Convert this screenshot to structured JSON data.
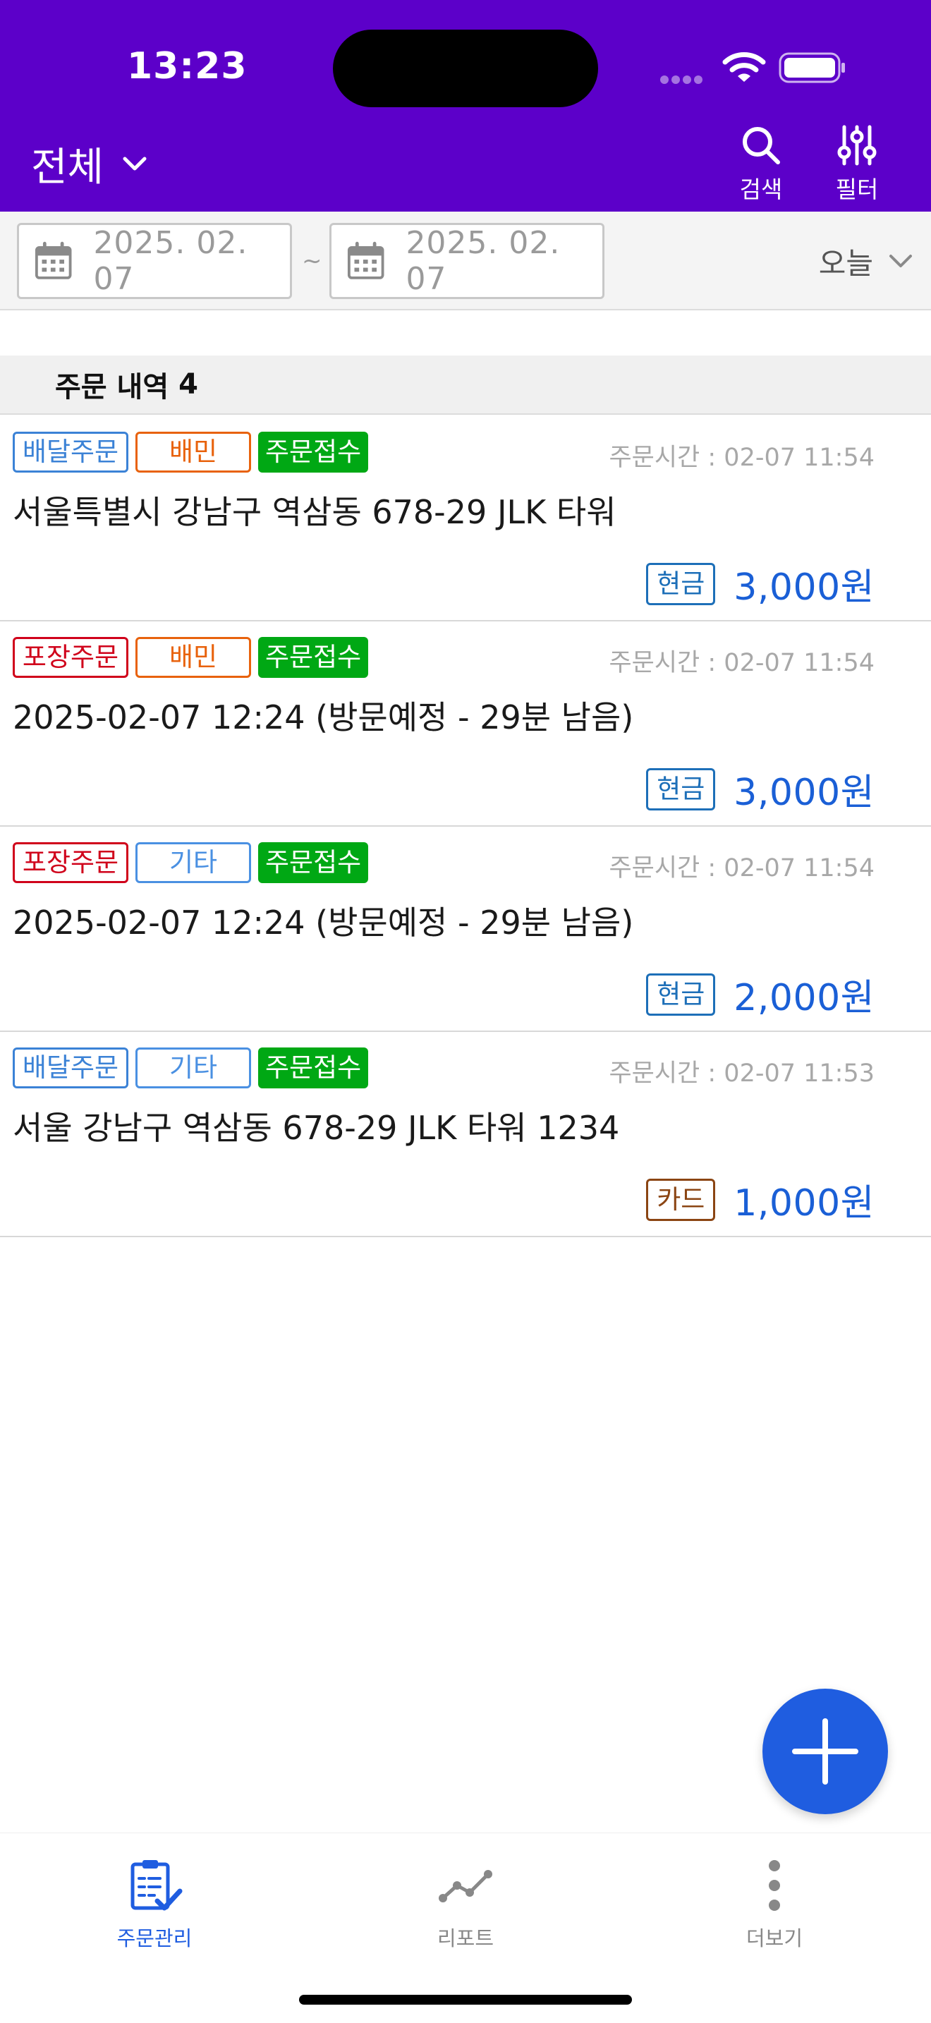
{
  "status_bar": {
    "time": "13:23"
  },
  "header": {
    "store_select_label": "전체",
    "actions": [
      {
        "label": "검색",
        "icon": "search-icon"
      },
      {
        "label": "필터",
        "icon": "filter-sliders-icon"
      }
    ],
    "background_color": "#5c00c9"
  },
  "date_filter": {
    "start_date": "2025. 02. 07",
    "separator": "~",
    "end_date": "2025. 02. 07",
    "period_label": "오늘"
  },
  "section": {
    "title": "주문 내역",
    "count": "4"
  },
  "orders": [
    {
      "order_type": "배달주문",
      "channel": "배민",
      "status": "주문접수",
      "time_label": "주문시간 : 02-07 11:54",
      "address": "서울특별시 강남구 역삼동 678-29 JLK 타워",
      "payment_method": "현금",
      "amount": "3,000원"
    },
    {
      "order_type": "포장주문",
      "channel": "배민",
      "status": "주문접수",
      "time_label": "주문시간 : 02-07 11:54",
      "address": "2025-02-07 12:24 (방문예정 - 29분 남음)",
      "payment_method": "현금",
      "amount": "3,000원"
    },
    {
      "order_type": "포장주문",
      "channel": "기타",
      "status": "주문접수",
      "time_label": "주문시간 : 02-07 11:54",
      "address": "2025-02-07 12:24 (방문예정 - 29분 남음)",
      "payment_method": "현금",
      "amount": "2,000원"
    },
    {
      "order_type": "배달주문",
      "channel": "기타",
      "status": "주문접수",
      "time_label": "주문시간 : 02-07 11:53",
      "address": "서울 강남구 역삼동 678-29 JLK 타워 1234",
      "payment_method": "카드",
      "amount": "1,000원"
    }
  ],
  "fab": {
    "icon": "plus-icon"
  },
  "tab_bar": {
    "tabs": [
      {
        "label": "주문관리",
        "icon": "clipboard-check-icon",
        "active": true
      },
      {
        "label": "리포트",
        "icon": "line-chart-icon",
        "active": false
      },
      {
        "label": "더보기",
        "icon": "more-vertical-icon",
        "active": false
      }
    ]
  },
  "colors": {
    "delivery": "#3b82d6",
    "takeout": "#d0021b",
    "baemin": "#e8620c",
    "etc": "#4a90e2",
    "status_received": "#00a814",
    "cash": "#1d6fb8",
    "card": "#8b4513",
    "amount": "#1a5fd6",
    "tab_active": "#1f5de0",
    "tab_inactive": "#888888"
  }
}
